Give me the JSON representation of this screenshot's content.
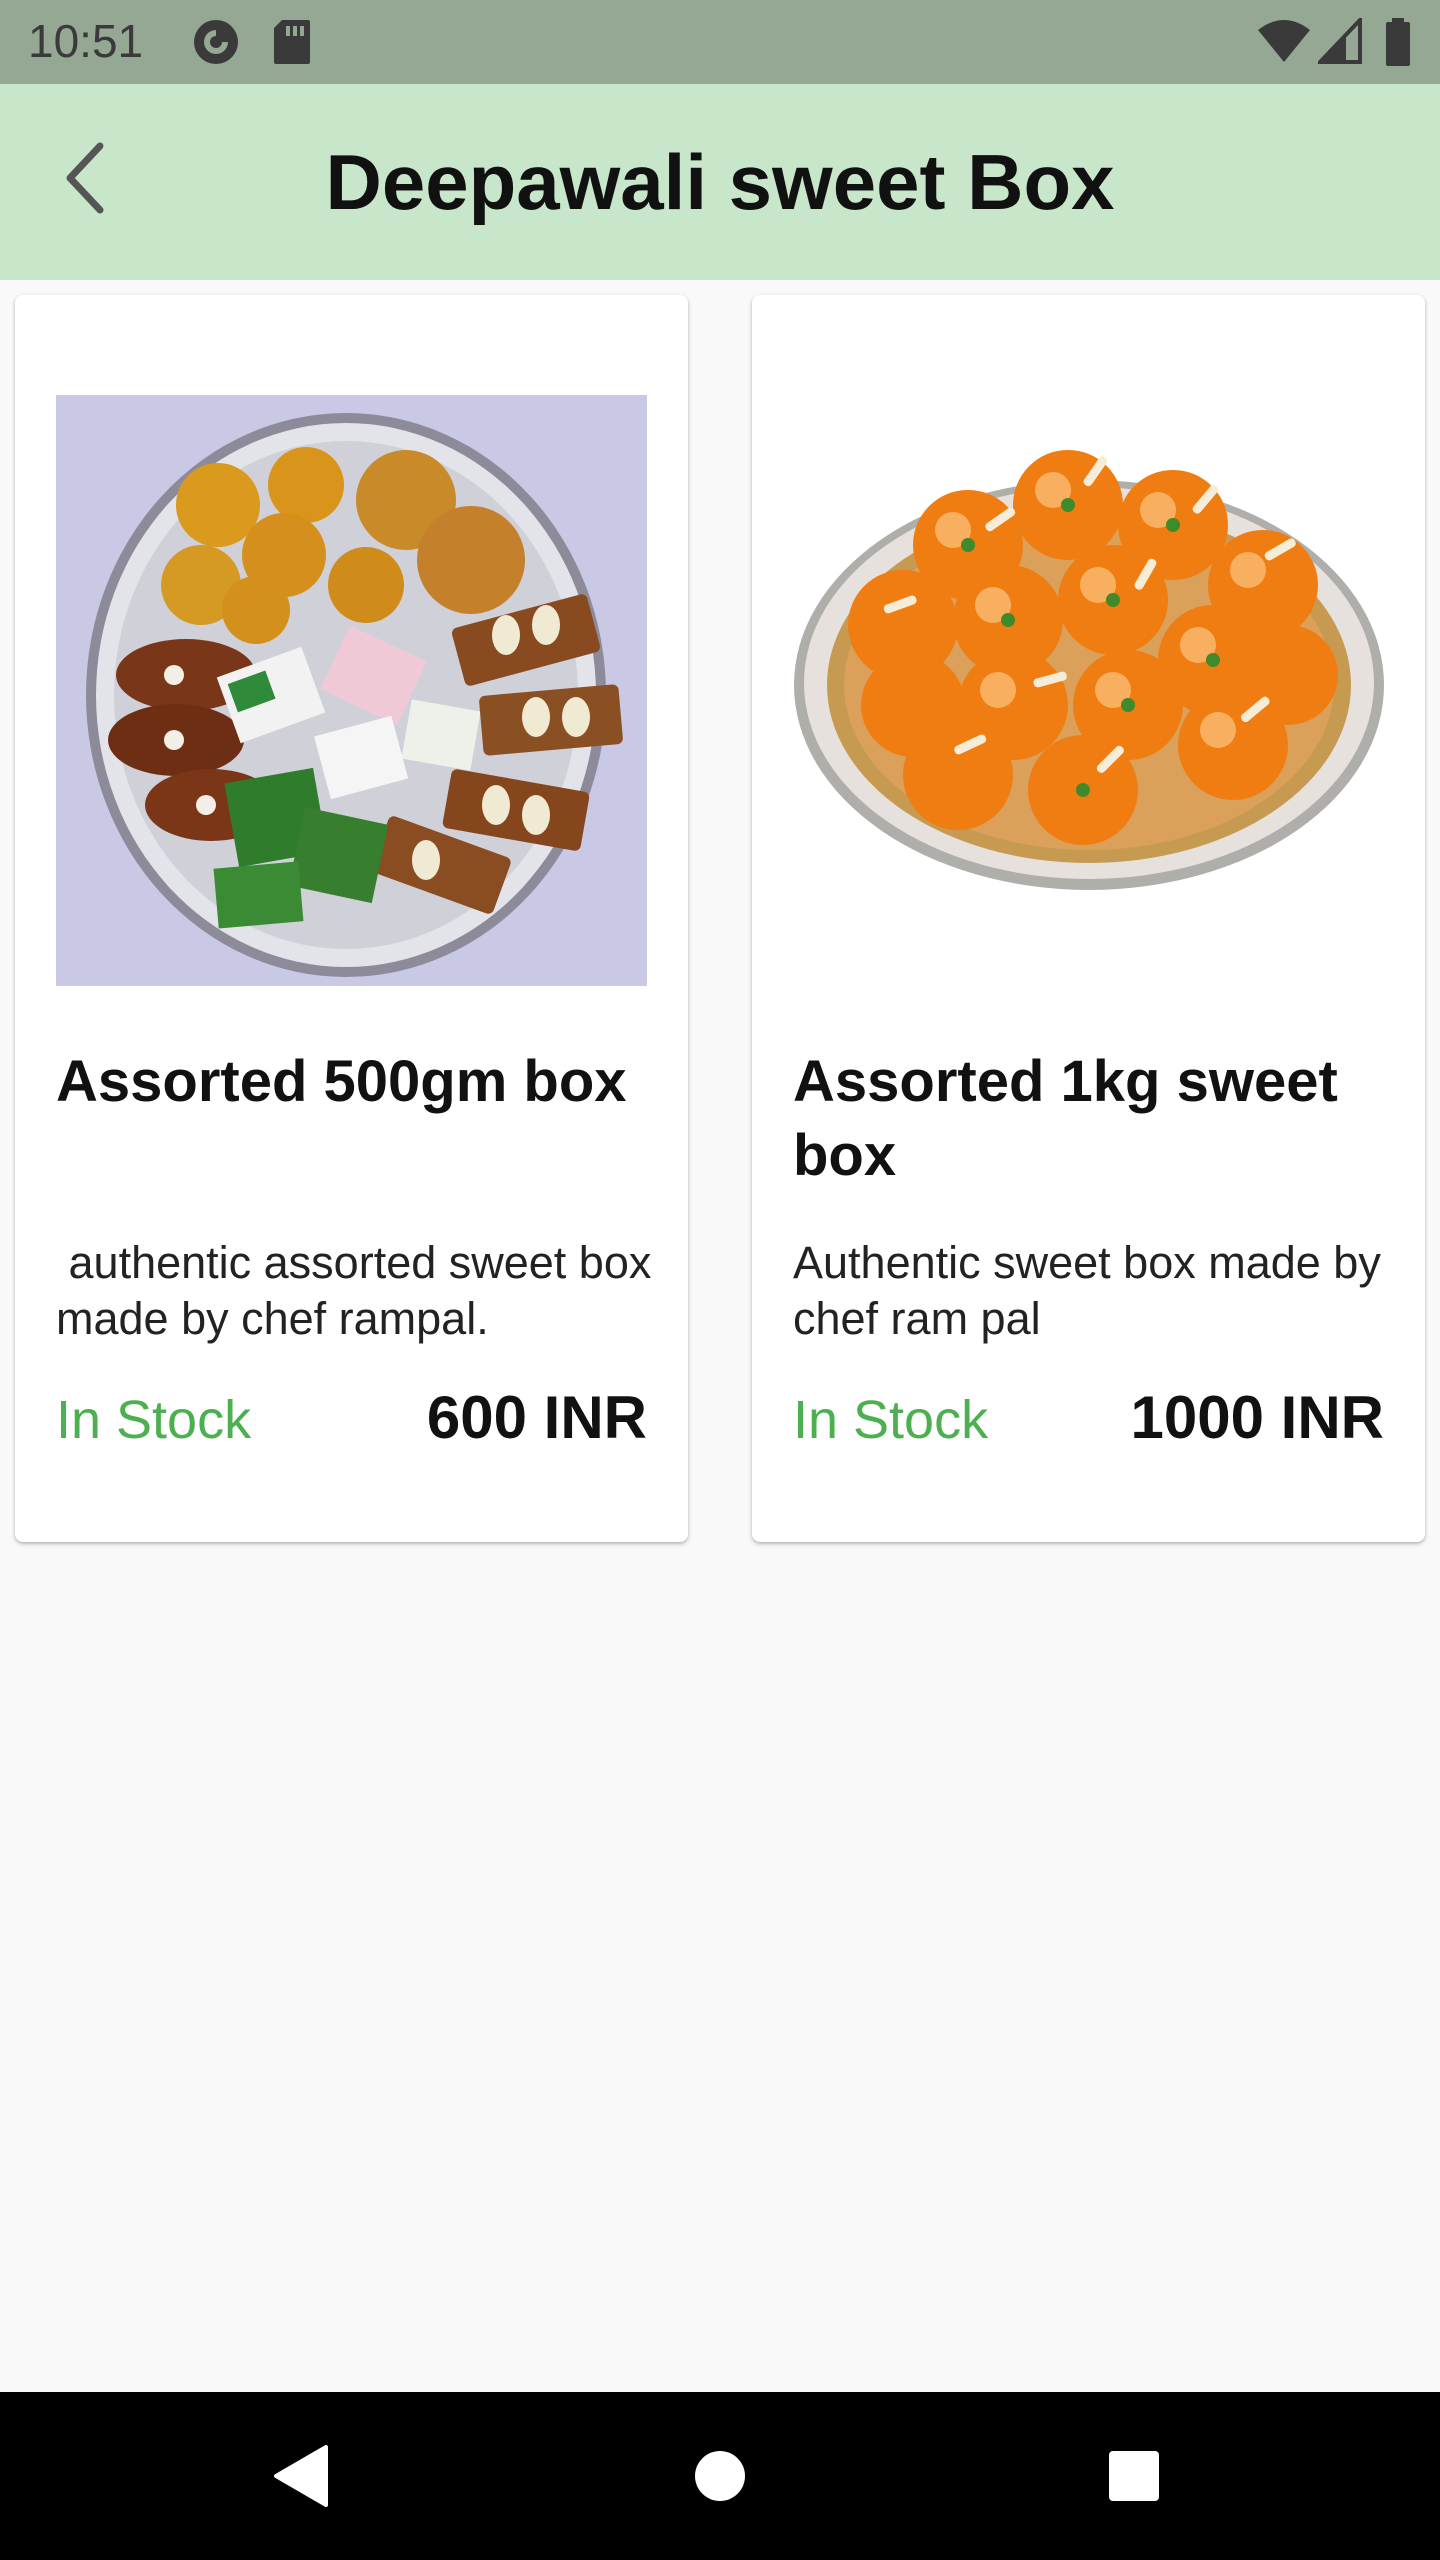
{
  "status_bar": {
    "time": "10:51",
    "icons": [
      "pocket-casts-icon",
      "sd-card-icon",
      "wifi-icon",
      "signal-icon",
      "battery-icon"
    ]
  },
  "app_bar": {
    "title": "Deepawali sweet Box",
    "back_icon": "chevron-left-icon"
  },
  "products": [
    {
      "name": "Assorted 500gm box",
      "description": " authentic assorted sweet box made by chef rampal.",
      "stock": "In Stock",
      "price": "600 INR",
      "image": "assorted-sweets-platter"
    },
    {
      "name": "Assorted 1kg sweet box",
      "description": "Authentic sweet box made by chef ram pal",
      "stock": "In Stock",
      "price": "1000 INR",
      "image": "laddoo-platter"
    }
  ],
  "nav_bar": {
    "buttons": [
      "back-triangle-icon",
      "home-circle-icon",
      "recents-square-icon"
    ]
  },
  "colors": {
    "status_bar": "#94a894",
    "app_bar": "#c8e6c9",
    "in_stock": "#4caf50",
    "background": "#f9f9f9"
  }
}
